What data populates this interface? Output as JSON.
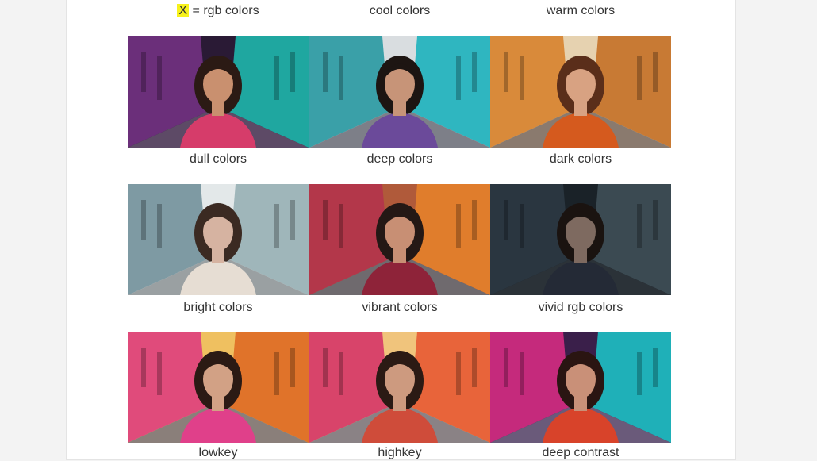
{
  "header": {
    "variable": "X",
    "definition": "= rgb colors",
    "col2": "cool colors",
    "col3": "warm colors"
  },
  "rows": [
    {
      "captions": [
        "dull colors",
        "deep colors",
        "dark colors"
      ],
      "tiles": [
        {
          "left": "#6b2f7a",
          "right": "#1fa7a0",
          "street": "#5d4a66",
          "top": "#2a1a35",
          "hair": "#2b1a14",
          "skin": "#c9906f",
          "coat": "#d63c6a"
        },
        {
          "left": "#3aa0a8",
          "right": "#2fb6c0",
          "street": "#7d7f88",
          "top": "#d9dde0",
          "hair": "#1d1512",
          "skin": "#c79478",
          "coat": "#6b4a9a"
        },
        {
          "left": "#d98a3a",
          "right": "#c87a34",
          "street": "#8a7a6e",
          "top": "#e6d2b0",
          "hair": "#5a2e1a",
          "skin": "#d8a282",
          "coat": "#d55a1e"
        }
      ]
    },
    {
      "captions": [
        "bright colors",
        "vibrant colors",
        "vivid rgb colors"
      ],
      "tiles": [
        {
          "left": "#7e9aa3",
          "right": "#9fb6ba",
          "street": "#9aa0a2",
          "top": "#e3e8e9",
          "hair": "#3b2a22",
          "skin": "#d6b3a1",
          "coat": "#e6ddd3"
        },
        {
          "left": "#b3374a",
          "right": "#e07d2c",
          "street": "#6f6a6e",
          "top": "#b05a3a",
          "hair": "#241815",
          "skin": "#c88f74",
          "coat": "#8e2339"
        },
        {
          "left": "#2a3640",
          "right": "#3b4a52",
          "street": "#2b3238",
          "top": "#1a2228",
          "hair": "#1a1310",
          "skin": "#7e6a60",
          "coat": "#242a36"
        }
      ]
    },
    {
      "captions": [
        "lowkey",
        "highkey",
        "deep contrast"
      ],
      "tiles": [
        {
          "left": "#e04b7b",
          "right": "#e0732a",
          "street": "#8a7f7a",
          "top": "#efc060",
          "hair": "#2b1a14",
          "skin": "#d2a185",
          "coat": "#e0408a"
        },
        {
          "left": "#d8446a",
          "right": "#e8643a",
          "street": "#8a8285",
          "top": "#f0c47c",
          "hair": "#2b1a14",
          "skin": "#cd9a7f",
          "coat": "#cf4c3a"
        },
        {
          "left": "#c52a7c",
          "right": "#1fb0b8",
          "street": "#6a5a7a",
          "top": "#3a1f4a",
          "hair": "#2a1512",
          "skin": "#c99078",
          "coat": "#d8432a"
        }
      ]
    }
  ]
}
